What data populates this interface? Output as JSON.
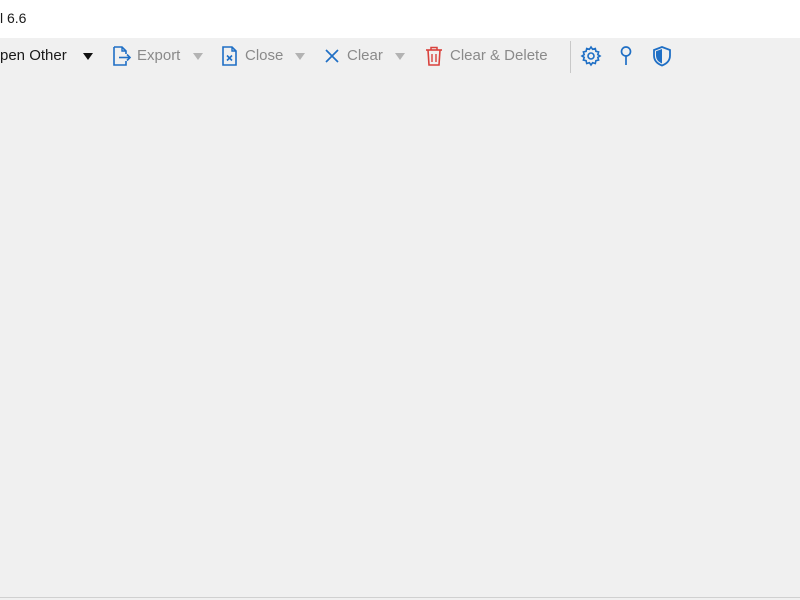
{
  "window": {
    "title": "l 6.6"
  },
  "toolbar": {
    "open_other_label": "pen Other",
    "export_label": "Export",
    "close_label": "Close",
    "clear_label": "Clear",
    "clear_delete_label": "Clear & Delete"
  },
  "icons": {
    "export": "export-icon",
    "close": "close-file-icon",
    "clear": "clear-x-icon",
    "clear_delete": "trash-icon",
    "settings": "gear-icon",
    "pin": "pin-icon",
    "shield": "shield-icon"
  },
  "colors": {
    "accent_blue": "#1f6fc5",
    "delete_red": "#d9413c",
    "disabled_text": "#8a8a8a"
  }
}
